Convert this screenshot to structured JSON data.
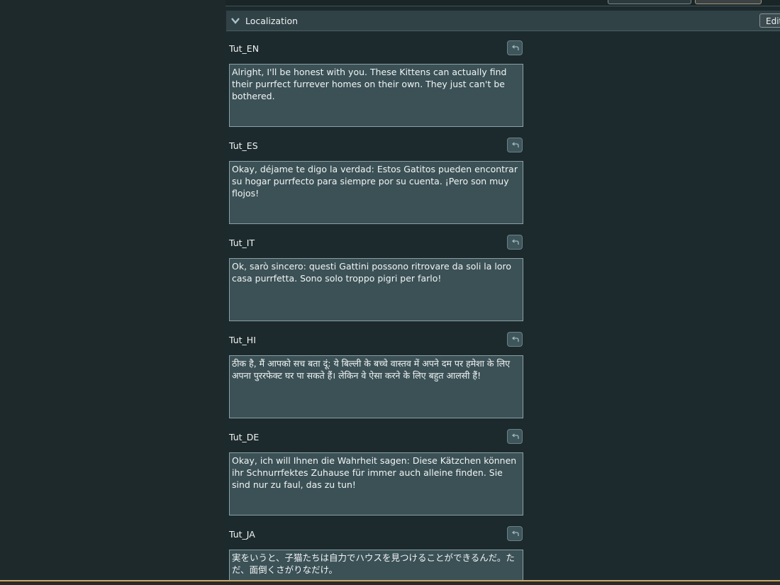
{
  "section": {
    "title": "Localization",
    "edit_label": "Edit"
  },
  "fields": [
    {
      "label": "Tut_EN",
      "value": "Alright, I'll be honest with you. These Kittens can actually find their purrfect furrever homes on their own. They just can't be bothered."
    },
    {
      "label": "Tut_ES",
      "value": "Okay, déjame te digo la verdad: Estos Gatitos pueden encontrar su hogar purrfecto para siempre por su cuenta. ¡Pero son muy flojos!"
    },
    {
      "label": "Tut_IT",
      "value": "Ok, sarò sincero: questi Gattini possono ritrovare da soli la loro casa purrfetta. Sono solo troppo pigri per farlo!"
    },
    {
      "label": "Tut_HI",
      "value": "ठीक है, मैं आपको सच बता दूं: ये बिल्ली के बच्चे वास्तव में अपने दम पर हमेशा के लिए अपना पुररफेक्ट घर पा सकते हैं। लेकिन वे ऐसा करने के लिए बहुत आलसी हैं!"
    },
    {
      "label": "Tut_DE",
      "value": "Okay, ich will Ihnen die Wahrheit sagen: Diese Kätzchen können ihr Schnurrfektes Zuhause für immer auch alleine finden. Sie sind nur zu faul, das zu tun!"
    },
    {
      "label": "Tut_JA",
      "value": "実をいうと、子猫たちは自力でハウスを見つけることができるんだ。ただ、面倒くさがりなだけ。"
    }
  ]
}
